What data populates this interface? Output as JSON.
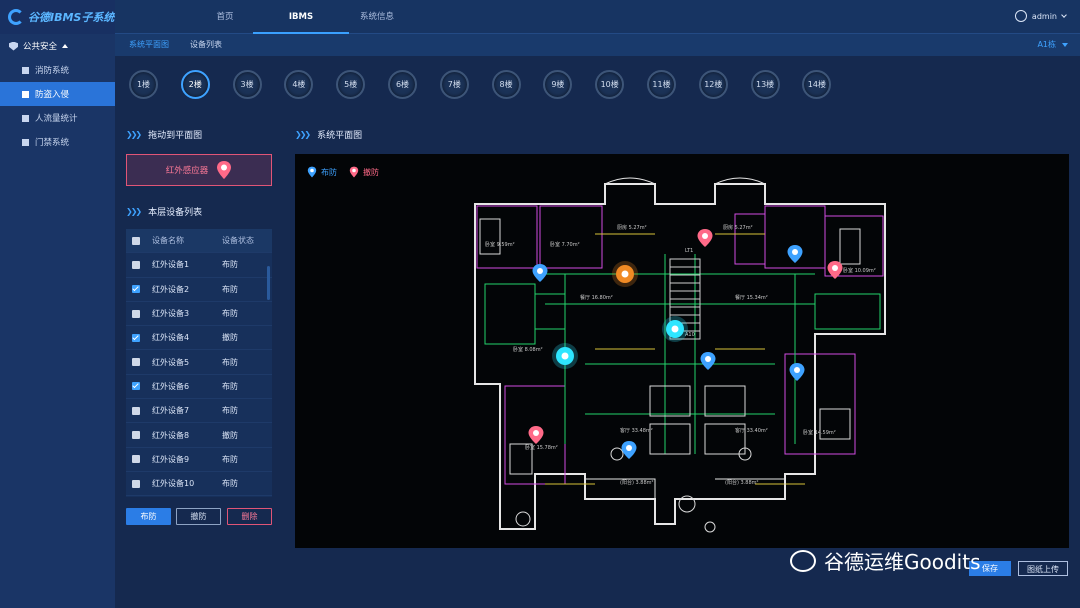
{
  "app": {
    "title": "谷德IBMS子系统"
  },
  "sidebar": {
    "group": "公共安全",
    "items": [
      "消防系统",
      "防盗入侵",
      "人流量统计",
      "门禁系统"
    ],
    "active_index": 1
  },
  "topnav": {
    "tabs": [
      "首页",
      "IBMS",
      "系统信息"
    ],
    "active": "IBMS",
    "user": "admin"
  },
  "subnav": {
    "tabs": [
      "系统平面图",
      "设备列表"
    ],
    "active": "系统平面图",
    "building": "A1栋"
  },
  "floors": [
    "1楼",
    "2楼",
    "3楼",
    "4楼",
    "5楼",
    "6楼",
    "7楼",
    "8楼",
    "9楼",
    "10楼",
    "11楼",
    "12楼",
    "13楼",
    "14楼"
  ],
  "active_floor": "2楼",
  "drag_panel": {
    "title": "拖动到平面图",
    "device": "红外感应器"
  },
  "list_panel": {
    "title": "本层设备列表",
    "col_name": "设备名称",
    "col_status": "设备状态",
    "rows": [
      {
        "name": "红外设备1",
        "status": "布防",
        "checked": false
      },
      {
        "name": "红外设备2",
        "status": "布防",
        "checked": true
      },
      {
        "name": "红外设备3",
        "status": "布防",
        "checked": false
      },
      {
        "name": "红外设备4",
        "status": "撤防",
        "checked": true
      },
      {
        "name": "红外设备5",
        "status": "布防",
        "checked": false
      },
      {
        "name": "红外设备6",
        "status": "布防",
        "checked": true
      },
      {
        "name": "红外设备7",
        "status": "布防",
        "checked": false
      },
      {
        "name": "红外设备8",
        "status": "撤防",
        "checked": false
      },
      {
        "name": "红外设备9",
        "status": "布防",
        "checked": false
      },
      {
        "name": "红外设备10",
        "status": "布防",
        "checked": false
      }
    ]
  },
  "buttons": {
    "arm": "布防",
    "disarm": "撤防",
    "delete": "删除"
  },
  "plan": {
    "title": "系统平面图",
    "legend_arm": "布防",
    "legend_disarm": "撤防",
    "room_labels": [
      "卧室 9.59m²",
      "卧室 7.70m²",
      "厨房 5.27m²",
      "厨房 5.27m²",
      "卧室 10.09m²",
      "餐厅 16.80m²",
      "餐厅 15.34m²",
      "卧室 8.08m²",
      "卧室 15.78m²",
      "客厅 33.48m²",
      "客厅 33.40m²",
      "卧室 14.59m²",
      "LT1",
      "A10",
      "(阳台) 3.88m²",
      "(阳台) 3.88m²"
    ]
  },
  "colors": {
    "armed": "#3ea2ff",
    "disarmed": "#ff6a88",
    "alert": "#f08a24",
    "active": "#2ee6ff"
  },
  "footer": {
    "btn1": "保存",
    "btn2": "图纸上传"
  },
  "watermark": "谷德运维Goodits"
}
